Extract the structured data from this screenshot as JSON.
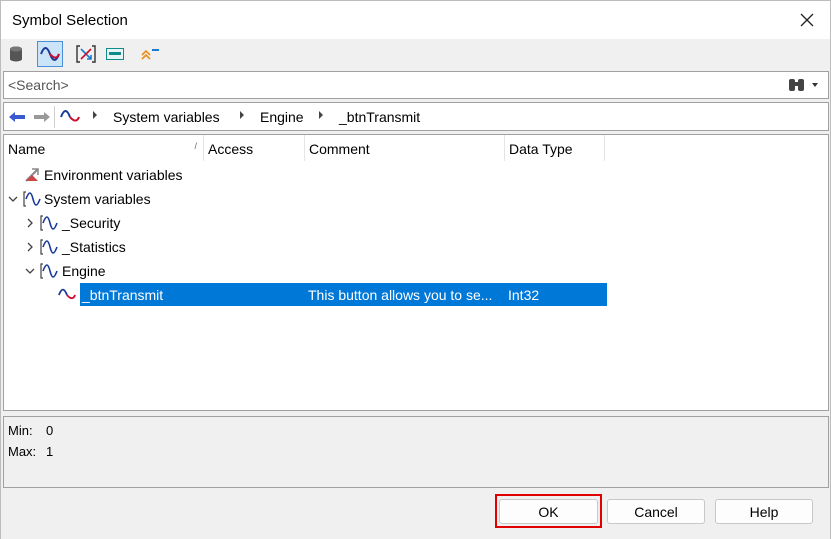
{
  "window": {
    "title": "Symbol Selection"
  },
  "toolbar": {
    "buttons": [
      {
        "icon": "database-icon"
      },
      {
        "icon": "signal-wave-icon",
        "active": true
      },
      {
        "icon": "mapping-icon"
      },
      {
        "icon": "signal-view-icon"
      },
      {
        "icon": "collapse-up-icon"
      }
    ]
  },
  "search": {
    "placeholder": "<Search>",
    "value": ""
  },
  "breadcrumb": {
    "items": [
      "System variables",
      "Engine",
      "_btnTransmit"
    ]
  },
  "table": {
    "columns": [
      "Name",
      "Access",
      "Comment",
      "Data Type"
    ],
    "rows": [
      {
        "name": "Environment variables",
        "icon": "environment-variables-icon",
        "expander": "",
        "access": "",
        "comment": "",
        "data_type": ""
      },
      {
        "name": "System variables",
        "icon": "system-variables-icon",
        "expander": "expanded",
        "access": "",
        "comment": "",
        "data_type": ""
      },
      {
        "name": "_Security",
        "icon": "namespace-icon",
        "expander": "collapsed",
        "access": "",
        "comment": "",
        "data_type": ""
      },
      {
        "name": "_Statistics",
        "icon": "namespace-icon",
        "expander": "collapsed",
        "access": "",
        "comment": "",
        "data_type": ""
      },
      {
        "name": "Engine",
        "icon": "namespace-icon",
        "expander": "expanded",
        "access": "",
        "comment": "",
        "data_type": ""
      },
      {
        "name": "_btnTransmit",
        "icon": "variable-icon",
        "expander": "",
        "access": "",
        "comment": "This button allows you to se...",
        "data_type": "Int32",
        "selected": true
      }
    ]
  },
  "info": {
    "min_label": "Min:",
    "min_value": "0",
    "max_label": "Max:",
    "max_value": "1"
  },
  "buttons": {
    "ok": "OK",
    "cancel": "Cancel",
    "help": "Help"
  },
  "colors": {
    "selection": "#0078d7",
    "highlight_border": "#e00000",
    "accent": "#4a90d9"
  }
}
